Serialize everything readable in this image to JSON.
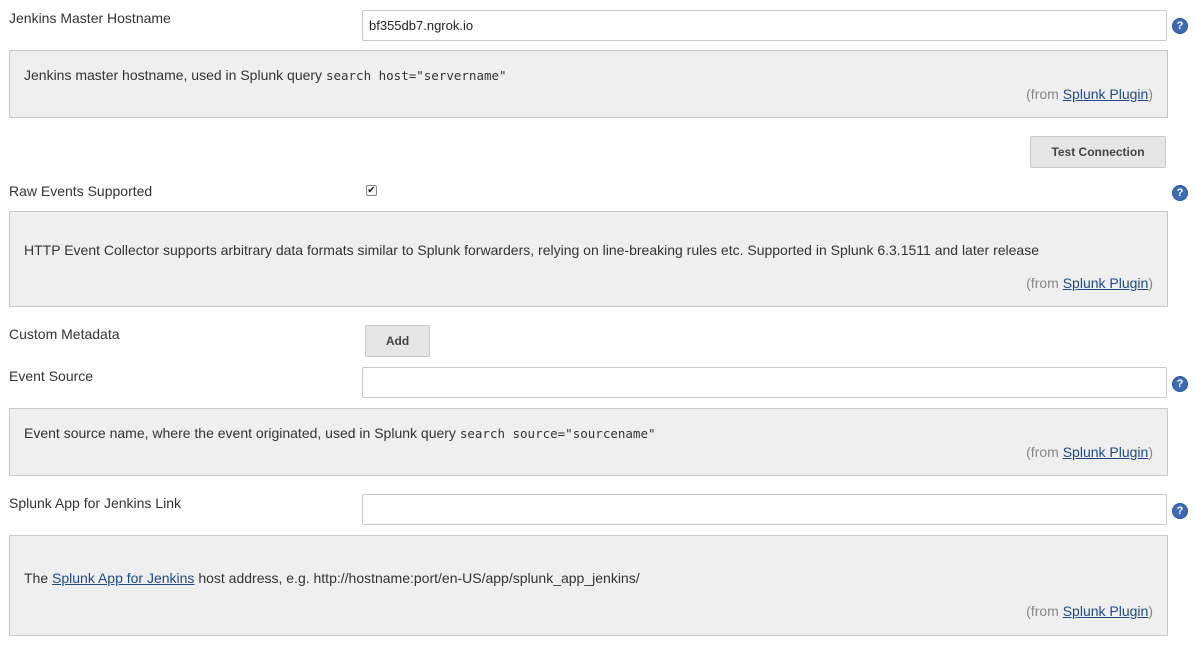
{
  "hostname": {
    "label": "Jenkins Master Hostname",
    "value": "bf355db7.ngrok.io",
    "help_text": "Jenkins master hostname, used in Splunk query ",
    "help_code": "search host=\"servername\""
  },
  "test_connection": {
    "label": "Test Connection"
  },
  "raw_events": {
    "label": "Raw Events Supported",
    "checked": true,
    "help_text": "HTTP Event Collector supports arbitrary data formats similar to Splunk forwarders, relying on line-breaking rules etc. Supported in Splunk 6.3.1511 and later release"
  },
  "custom_metadata": {
    "label": "Custom Metadata",
    "add_label": "Add"
  },
  "event_source": {
    "label": "Event Source",
    "value": "",
    "help_text": "Event source name, where the event originated, used in Splunk query ",
    "help_code": "search source=\"sourcename\""
  },
  "app_link": {
    "label": "Splunk App for Jenkins Link",
    "value": "",
    "help_prefix": "The ",
    "help_link": "Splunk App for Jenkins",
    "help_suffix": " host address, e.g. http://hostname:port/en-US/app/splunk_app_jenkins/"
  },
  "from": {
    "open": "(from ",
    "link": "Splunk Plugin",
    "close": ")"
  },
  "icons": {
    "help": "?",
    "check": "✔"
  }
}
